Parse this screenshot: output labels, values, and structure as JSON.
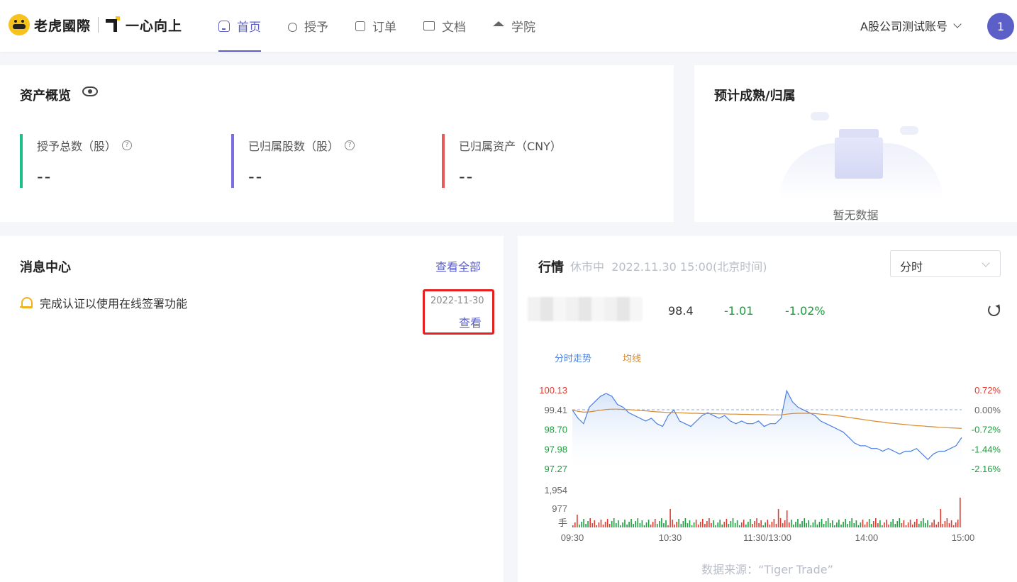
{
  "header": {
    "brand": "老虎國際",
    "slogan": "一心向上",
    "nav": [
      {
        "label": "首页",
        "icon": "home-icon",
        "active": true
      },
      {
        "label": "授予",
        "icon": "medal-icon",
        "active": false
      },
      {
        "label": "订单",
        "icon": "order-icon",
        "active": false
      },
      {
        "label": "文档",
        "icon": "folder-icon",
        "active": false
      },
      {
        "label": "学院",
        "icon": "graduation-cap-icon",
        "active": false
      }
    ],
    "account": "A股公司测试账号",
    "avatar": "1"
  },
  "assets": {
    "title": "资产概览",
    "stats": [
      {
        "label": "授予总数（股）",
        "value": "--",
        "color": "#1ec08a",
        "help": true
      },
      {
        "label": "已归属股数（股）",
        "value": "--",
        "color": "#7b6fe0",
        "help": true
      },
      {
        "label": "已归属资产（CNY）",
        "value": "--",
        "color": "#e65a5a",
        "help": false
      }
    ]
  },
  "vesting": {
    "title": "预计成熟/归属",
    "empty": "暂无数据"
  },
  "messages": {
    "title": "消息中心",
    "view_all": "查看全部",
    "items": [
      {
        "text": "完成认证以使用在线签署功能",
        "date": "2022-11-30",
        "action": "查看"
      }
    ]
  },
  "market": {
    "title": "行情",
    "status": "休市中",
    "time": "2022.11.30 15:00(北京时间)",
    "period": "分时",
    "price": "98.4",
    "change": "-1.01",
    "change_pct": "-1.02%",
    "source": "数据来源：“Tiger Trade”"
  },
  "colors": {
    "accent": "#5b5fc7",
    "up": "#e03a2f",
    "down": "#19a03c",
    "price_line": "#4a7fe0",
    "avg_line": "#d88a2c"
  },
  "chart_data": {
    "type": "line",
    "legend": [
      "分时走势",
      "均线"
    ],
    "prev_close": 99.41,
    "ylim": [
      97.27,
      100.13
    ],
    "left_ticks": [
      "100.13",
      "99.41",
      "98.70",
      "97.98",
      "97.27"
    ],
    "right_ticks": [
      "0.72%",
      "0.00%",
      "-0.72%",
      "-1.44%",
      "-2.16%"
    ],
    "volume_ticks": [
      "1,954",
      "977",
      "手"
    ],
    "x_labels": [
      "09:30",
      "10:30",
      "11:30/13:00",
      "14:00",
      "15:00"
    ],
    "price": [
      99.4,
      99.1,
      98.9,
      99.5,
      99.7,
      99.9,
      100.0,
      99.9,
      99.6,
      99.5,
      99.3,
      99.2,
      99.1,
      99.0,
      99.1,
      98.9,
      98.8,
      99.2,
      99.4,
      99.0,
      98.9,
      98.8,
      99.0,
      99.2,
      99.3,
      99.2,
      99.1,
      99.2,
      99.0,
      98.9,
      99.0,
      98.9,
      98.9,
      99.0,
      98.8,
      98.9,
      98.9,
      99.1,
      100.1,
      99.7,
      99.5,
      99.4,
      99.3,
      99.2,
      99.0,
      98.9,
      98.8,
      98.7,
      98.6,
      98.4,
      98.2,
      98.1,
      98.1,
      98.0,
      98.0,
      97.9,
      98.0,
      97.9,
      97.8,
      97.9,
      97.9,
      98.0,
      97.8,
      97.6,
      97.8,
      97.9,
      97.9,
      98.0,
      98.1,
      98.4
    ],
    "avg": [
      99.4,
      99.35,
      99.32,
      99.33,
      99.36,
      99.39,
      99.42,
      99.43,
      99.43,
      99.42,
      99.41,
      99.4,
      99.38,
      99.37,
      99.35,
      99.33,
      99.32,
      99.31,
      99.31,
      99.3,
      99.29,
      99.28,
      99.28,
      99.27,
      99.27,
      99.27,
      99.26,
      99.26,
      99.25,
      99.25,
      99.24,
      99.24,
      99.23,
      99.23,
      99.23,
      99.22,
      99.22,
      99.22,
      99.25,
      99.27,
      99.28,
      99.28,
      99.28,
      99.27,
      99.25,
      99.23,
      99.21,
      99.19,
      99.16,
      99.13,
      99.1,
      99.07,
      99.04,
      99.01,
      98.98,
      98.96,
      98.93,
      98.91,
      98.89,
      98.87,
      98.85,
      98.83,
      98.82,
      98.8,
      98.79,
      98.77,
      98.76,
      98.75,
      98.74,
      98.73
    ],
    "volume_max": 1954
  }
}
